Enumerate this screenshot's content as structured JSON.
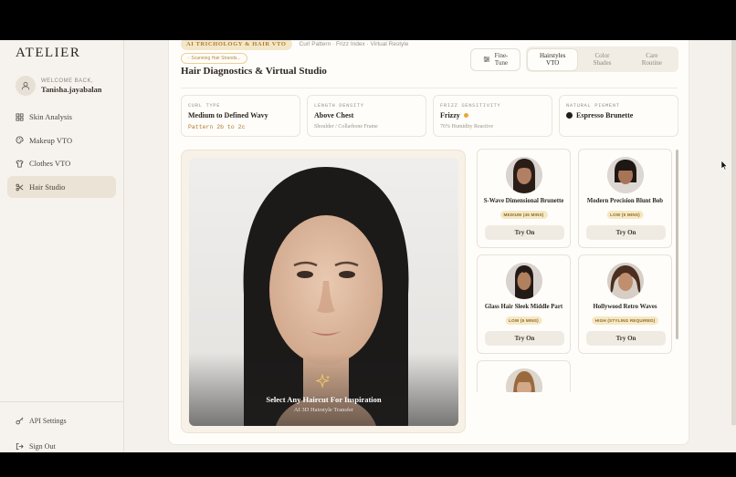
{
  "brand": "ATELIER",
  "user": {
    "welcome": "WELCOME BACK,",
    "name": "Tanisha.jayabalan"
  },
  "nav": [
    {
      "label": "Skin Analysis",
      "icon": "grid-icon"
    },
    {
      "label": "Makeup VTO",
      "icon": "palette-icon"
    },
    {
      "label": "Clothes VTO",
      "icon": "shirt-icon"
    },
    {
      "label": "Hair Studio",
      "icon": "scissors-icon",
      "active": true
    }
  ],
  "sidebar_bottom": {
    "api": "API Settings",
    "signout": "Sign Out"
  },
  "header": {
    "tag": "AI TRICHOLOGY & HAIR VTO",
    "tag_sub": "Curl Pattern · Frizz Index · Virtual Restyle",
    "scanning": "Scanning Hair Strands...",
    "title": "Hair Diagnostics & Virtual Studio"
  },
  "toolbar": {
    "fine_tune": "Fine-\nTune",
    "tabs": [
      {
        "label": "Hairstyles\nVTO",
        "active": true
      },
      {
        "label": "Color\nShades"
      },
      {
        "label": "Care\nRoutine"
      }
    ]
  },
  "stats": [
    {
      "label": "CURL TYPE",
      "value": "Medium to Defined Wavy",
      "sub": "Pattern 2b to 2c",
      "mono": true
    },
    {
      "label": "LENGTH DENSITY",
      "value": "Above Chest",
      "sub": "Shoulder / Collarbone Frame"
    },
    {
      "label": "FRIZZ SENSITIVITY",
      "value": "Frizzy",
      "sub": "76% Humidity Reactive"
    },
    {
      "label": "NATURAL PIGMENT",
      "value": "Espresso Brunette"
    }
  ],
  "photo": {
    "title": "Select Any Haircut For Inspiration",
    "subtitle": "AI 3D Hairstyle Transfer"
  },
  "styles": [
    {
      "name": "S-Wave Dimensional Brunette",
      "badge": "MEDIUM (45 MINS)",
      "cta": "Try On"
    },
    {
      "name": "Modern Precision Blunt Bob",
      "badge": "LOW (5 MINS)",
      "cta": "Try On"
    },
    {
      "name": "Glass Hair Sleek Middle Part",
      "badge": "LOW (5 MINS)",
      "cta": "Try On"
    },
    {
      "name": "Hollywood Retro Waves",
      "badge": "HIGH (STYLING REQUIRED)",
      "cta": "Try On"
    },
    {
      "name": "",
      "badge": "",
      "cta": ""
    }
  ]
}
